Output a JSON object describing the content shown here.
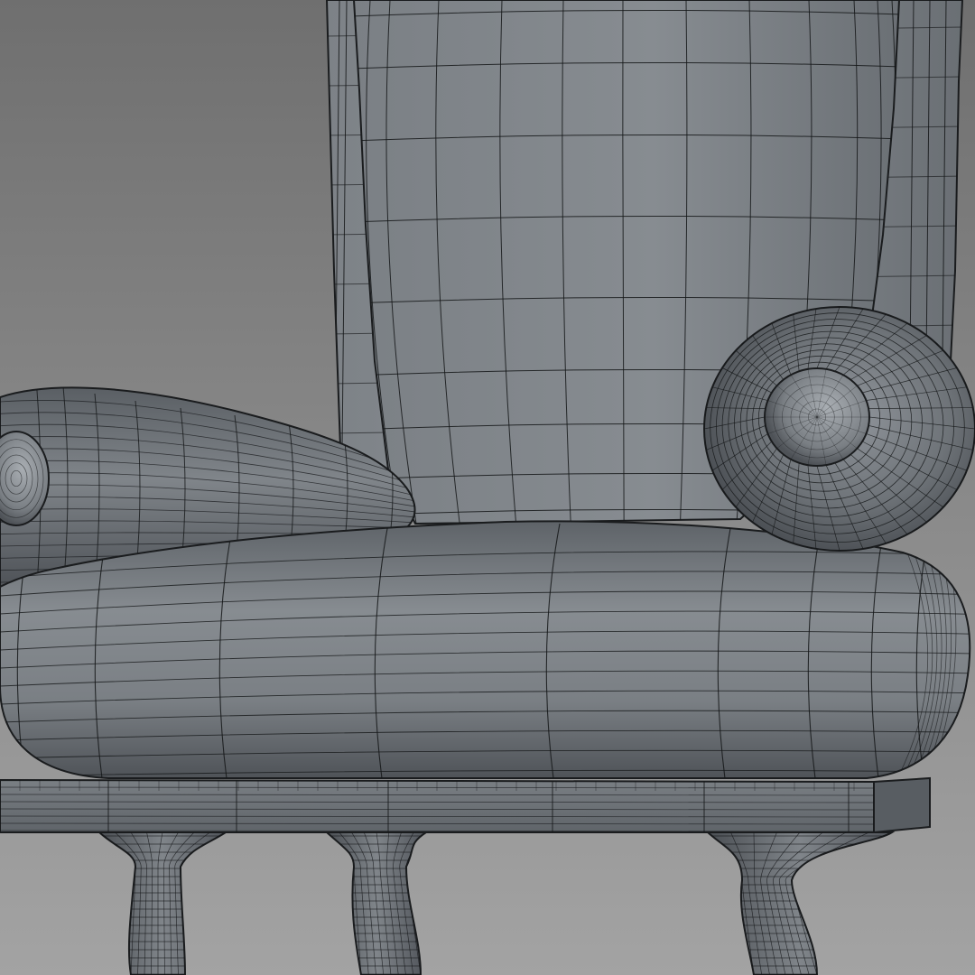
{
  "viewport": {
    "background_top": "#6f6f6f",
    "background_bottom": "#a3a3a3"
  },
  "model": {
    "surface_color": "#6d7277",
    "surface_highlight": "#a7adb2",
    "surface_shadow": "#2f3337",
    "wire_color": "#141618",
    "parts": [
      "backrest-frame",
      "back-cushion",
      "left-armrest-bolster",
      "right-armrest-bolster",
      "seat-cushion",
      "seat-base",
      "chair-leg"
    ]
  }
}
